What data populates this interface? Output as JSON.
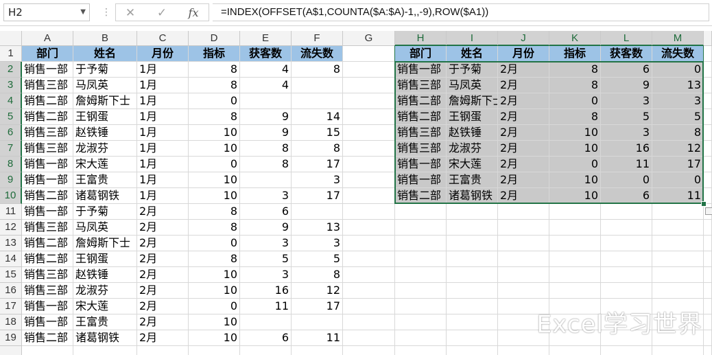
{
  "name_box": "H2",
  "formula": "=INDEX(OFFSET(A$1,COUNTA($A:$A)-1,,-9),ROW($A1))",
  "columns": [
    "A",
    "B",
    "C",
    "D",
    "E",
    "F",
    "G",
    "H",
    "I",
    "J",
    "K",
    "L",
    "M"
  ],
  "rows": [
    "1",
    "2",
    "3",
    "4",
    "5",
    "6",
    "7",
    "8",
    "9",
    "10",
    "11",
    "12",
    "13",
    "14",
    "15",
    "16",
    "17",
    "18",
    "19"
  ],
  "source_table": {
    "headers": [
      "部门",
      "姓名",
      "月份",
      "指标",
      "获客数",
      "流失数"
    ],
    "rows": [
      [
        "销售一部",
        "于予菊",
        "1月",
        "8",
        "4",
        "8"
      ],
      [
        "销售三部",
        "马凤英",
        "1月",
        "8",
        "4",
        ""
      ],
      [
        "销售二部",
        "詹姆斯下士",
        "1月",
        "0",
        "",
        ""
      ],
      [
        "销售二部",
        "王钢蛋",
        "1月",
        "8",
        "9",
        "14"
      ],
      [
        "销售三部",
        "赵铁锤",
        "1月",
        "10",
        "9",
        "15"
      ],
      [
        "销售三部",
        "龙淑芬",
        "1月",
        "10",
        "8",
        "8"
      ],
      [
        "销售一部",
        "宋大莲",
        "1月",
        "0",
        "8",
        "17"
      ],
      [
        "销售一部",
        "王富贵",
        "1月",
        "10",
        "",
        "3"
      ],
      [
        "销售二部",
        "诸葛钢铁",
        "1月",
        "10",
        "3",
        "17"
      ],
      [
        "销售一部",
        "于予菊",
        "2月",
        "8",
        "6",
        ""
      ],
      [
        "销售三部",
        "马凤英",
        "2月",
        "8",
        "9",
        "13"
      ],
      [
        "销售二部",
        "詹姆斯下士",
        "2月",
        "0",
        "3",
        "3"
      ],
      [
        "销售二部",
        "王钢蛋",
        "2月",
        "8",
        "5",
        "5"
      ],
      [
        "销售三部",
        "赵铁锤",
        "2月",
        "10",
        "3",
        "8"
      ],
      [
        "销售三部",
        "龙淑芬",
        "2月",
        "10",
        "16",
        "12"
      ],
      [
        "销售一部",
        "宋大莲",
        "2月",
        "0",
        "11",
        "17"
      ],
      [
        "销售一部",
        "王富贵",
        "2月",
        "10",
        "",
        ""
      ],
      [
        "销售二部",
        "诸葛钢铁",
        "2月",
        "10",
        "6",
        "11"
      ]
    ]
  },
  "result_table": {
    "headers": [
      "部门",
      "姓名",
      "月份",
      "指标",
      "获客数",
      "流失数"
    ],
    "rows": [
      [
        "销售一部",
        "于予菊",
        "2月",
        "8",
        "6",
        "0"
      ],
      [
        "销售三部",
        "马凤英",
        "2月",
        "8",
        "9",
        "13"
      ],
      [
        "销售二部",
        "詹姆斯下士",
        "2月",
        "0",
        "3",
        "3"
      ],
      [
        "销售二部",
        "王钢蛋",
        "2月",
        "8",
        "5",
        "5"
      ],
      [
        "销售三部",
        "赵铁锤",
        "2月",
        "10",
        "3",
        "8"
      ],
      [
        "销售三部",
        "龙淑芬",
        "2月",
        "10",
        "16",
        "12"
      ],
      [
        "销售一部",
        "宋大莲",
        "2月",
        "0",
        "11",
        "17"
      ],
      [
        "销售一部",
        "王富贵",
        "2月",
        "10",
        "0",
        "0"
      ],
      [
        "销售二部",
        "诸葛钢铁",
        "2月",
        "10",
        "6",
        "11"
      ]
    ]
  },
  "watermark": "Excel学习世界",
  "colors": {
    "header_fill": "#9dc3e6",
    "selection_fill": "#c9c9c9",
    "selection_border": "#217346"
  }
}
